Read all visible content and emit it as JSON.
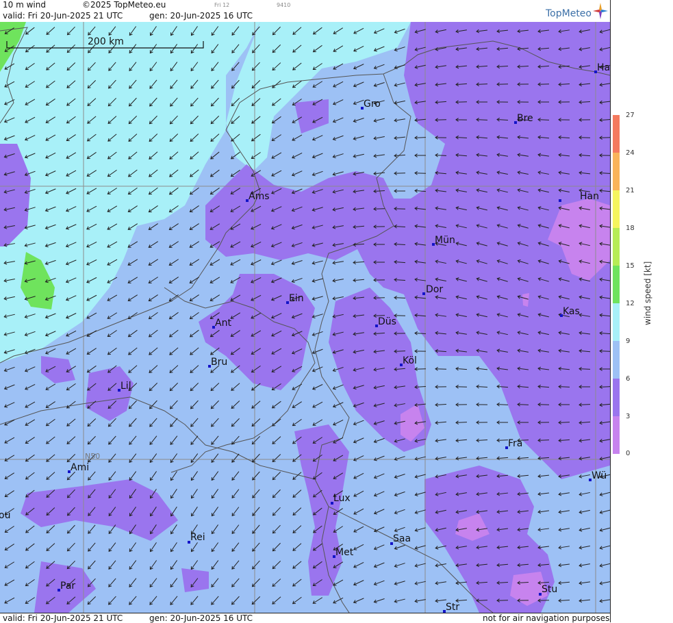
{
  "header": {
    "product": "10 m wind",
    "copyright": "©2025 TopMeteo.eu",
    "step_label": "Fri 12",
    "code": "9410",
    "valid": "valid:  Fri  20-Jun-2025  21 UTC",
    "gen": "gen: 20-Jun-2025 16 UTC",
    "brand": "TopMeteo"
  },
  "footer": {
    "valid": "valid:  Fri  20-Jun-2025  21 UTC",
    "gen": "gen: 20-Jun-2025 16 UTC",
    "disclaimer": "not for air navigation purposes"
  },
  "map": {
    "scale_label": "200 km",
    "lat_label": "N50",
    "cities": [
      {
        "name": "Gro"
      },
      {
        "name": "Bre"
      },
      {
        "name": "Ha"
      },
      {
        "name": "Ams"
      },
      {
        "name": "Han"
      },
      {
        "name": "Mün"
      },
      {
        "name": "Ein"
      },
      {
        "name": "Dor"
      },
      {
        "name": "Ant"
      },
      {
        "name": "Düs"
      },
      {
        "name": "Kas"
      },
      {
        "name": "Bru"
      },
      {
        "name": "Köl"
      },
      {
        "name": "Lil"
      },
      {
        "name": "Fra"
      },
      {
        "name": "Ami"
      },
      {
        "name": "Wü"
      },
      {
        "name": "Lux"
      },
      {
        "name": "ou"
      },
      {
        "name": "Rei"
      },
      {
        "name": "Saa"
      },
      {
        "name": "Met"
      },
      {
        "name": "Par"
      },
      {
        "name": "Stu"
      },
      {
        "name": "Str"
      }
    ]
  },
  "legend": {
    "unit": "wind speed [kt]",
    "ticks": [
      "27",
      "24",
      "21",
      "18",
      "15",
      "12",
      "9",
      "6",
      "3",
      "0"
    ],
    "colors": {
      "0_3": "#c783ee",
      "3_6": "#9a75ee",
      "6_9": "#9dc1f5",
      "9_12": "#a8f0f8",
      "12_15": "#6fe35d",
      "15_18": "#b6ec55",
      "18_21": "#f5f55e",
      "21_24": "#f9b45a",
      "24_27": "#f47a5e"
    }
  },
  "colors": {
    "border": "#555555",
    "grid": "#8c8c8c",
    "arrow": "#222222",
    "city_marker": "#1414c8"
  }
}
